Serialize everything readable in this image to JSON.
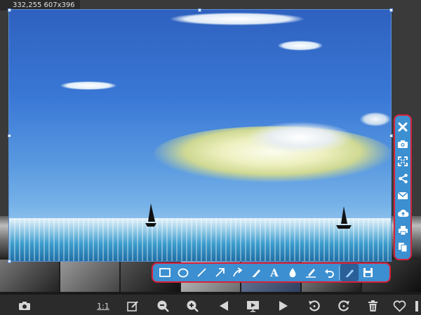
{
  "selection": {
    "coords_readout": "332,255 607x396"
  },
  "side_toolbar": {
    "items": [
      {
        "name": "close-icon"
      },
      {
        "name": "camera-icon"
      },
      {
        "name": "fullscreen-icon"
      },
      {
        "name": "share-icon"
      },
      {
        "name": "mail-icon"
      },
      {
        "name": "cloud-upload-icon"
      },
      {
        "name": "printer-icon"
      },
      {
        "name": "copy-icon"
      }
    ]
  },
  "draw_toolbar": {
    "text_tool_label": "A",
    "items": [
      {
        "name": "rectangle-icon"
      },
      {
        "name": "ellipse-icon"
      },
      {
        "name": "line-icon"
      },
      {
        "name": "arrow-icon"
      },
      {
        "name": "curved-arrow-icon"
      },
      {
        "name": "pen-icon"
      },
      {
        "name": "text-icon"
      },
      {
        "name": "blur-drop-icon"
      },
      {
        "name": "marker-icon"
      },
      {
        "name": "undo-icon"
      },
      {
        "name": "color-picker-icon"
      },
      {
        "name": "save-icon"
      }
    ]
  },
  "viewer_toolbar": {
    "ratio_label": "1:1",
    "items": [
      {
        "name": "camera-icon"
      },
      {
        "name": "edit-icon"
      },
      {
        "name": "zoom-out-icon"
      },
      {
        "name": "zoom-in-icon"
      },
      {
        "name": "previous-icon"
      },
      {
        "name": "slideshow-icon"
      },
      {
        "name": "next-icon"
      },
      {
        "name": "rotate-left-icon"
      },
      {
        "name": "rotate-right-icon"
      },
      {
        "name": "delete-icon"
      },
      {
        "name": "favorite-icon"
      },
      {
        "name": "info-icon"
      }
    ]
  },
  "colors": {
    "toolbar_blue": "#3c8fd0",
    "toolbar_border_red": "#d8213b",
    "selection_blue": "#5a8fd4",
    "background_dark": "#2b2b2b"
  }
}
